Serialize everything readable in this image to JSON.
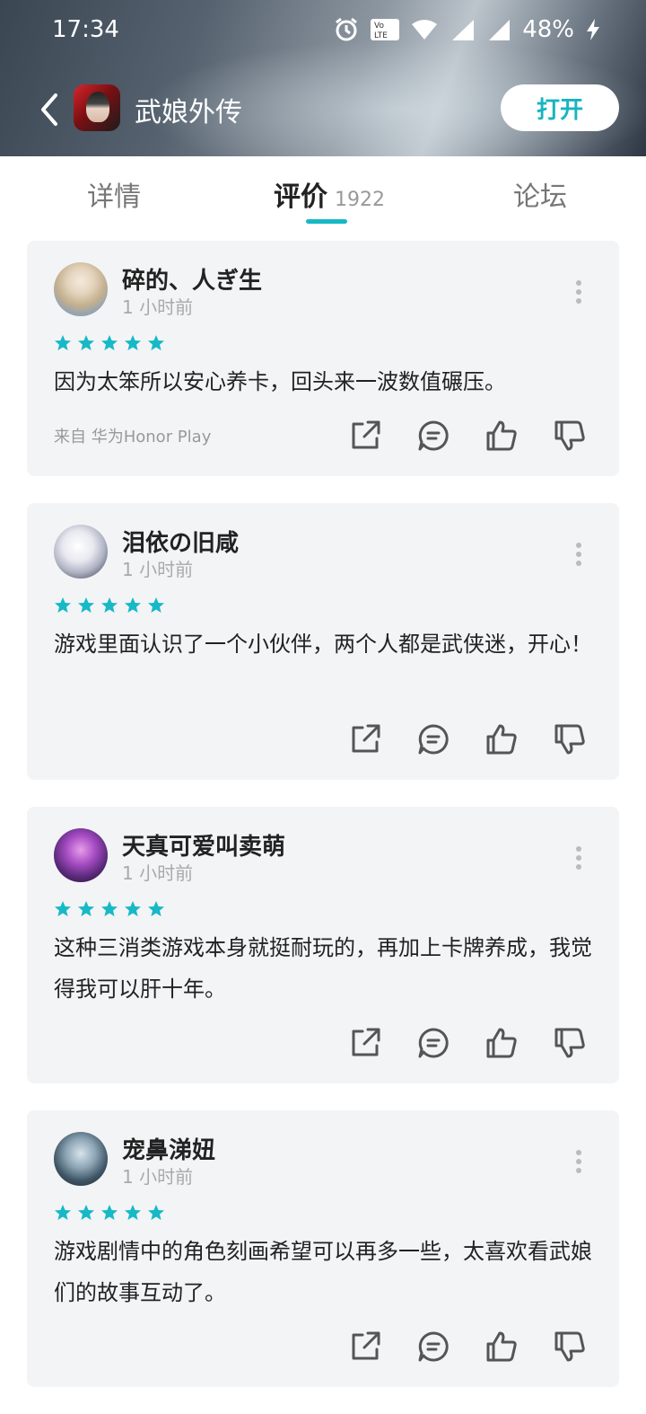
{
  "status_bar": {
    "time": "17:34",
    "battery": "48%",
    "icons": [
      "alarm-icon",
      "volte-icon",
      "wifi-icon",
      "4g-signal-icon",
      "g-signal-icon",
      "charging-icon"
    ]
  },
  "header": {
    "app_name": "武娘外传",
    "open_button": "打开"
  },
  "tabs": [
    {
      "label": "详情"
    },
    {
      "label": "评价",
      "count": "1922",
      "active": true
    },
    {
      "label": "论坛"
    }
  ],
  "reviews": [
    {
      "user": "碎的、人ぎ生",
      "time": "1 小时前",
      "stars": 5,
      "text": "因为太笨所以安心养卡，回头来一波数值碾压。",
      "source": "来自 华为Honor Play"
    },
    {
      "user": "泪依の旧咸",
      "time": "1 小时前",
      "stars": 5,
      "text": "游戏里面认识了一个小伙伴，两个人都是武侠迷，开心！",
      "source": ""
    },
    {
      "user": "天真可爱叫卖萌",
      "time": "1 小时前",
      "stars": 5,
      "text": "这种三消类游戏本身就挺耐玩的，再加上卡牌养成，我觉得我可以肝十年。",
      "source": ""
    },
    {
      "user": "宠鼻涕妞",
      "time": "1 小时前",
      "stars": 5,
      "text": "游戏剧情中的角色刻画希望可以再多一些，太喜欢看武娘们的故事互动了。",
      "source": ""
    }
  ],
  "colors": {
    "accent": "#17b9c6",
    "card_bg": "#f3f4f6"
  }
}
